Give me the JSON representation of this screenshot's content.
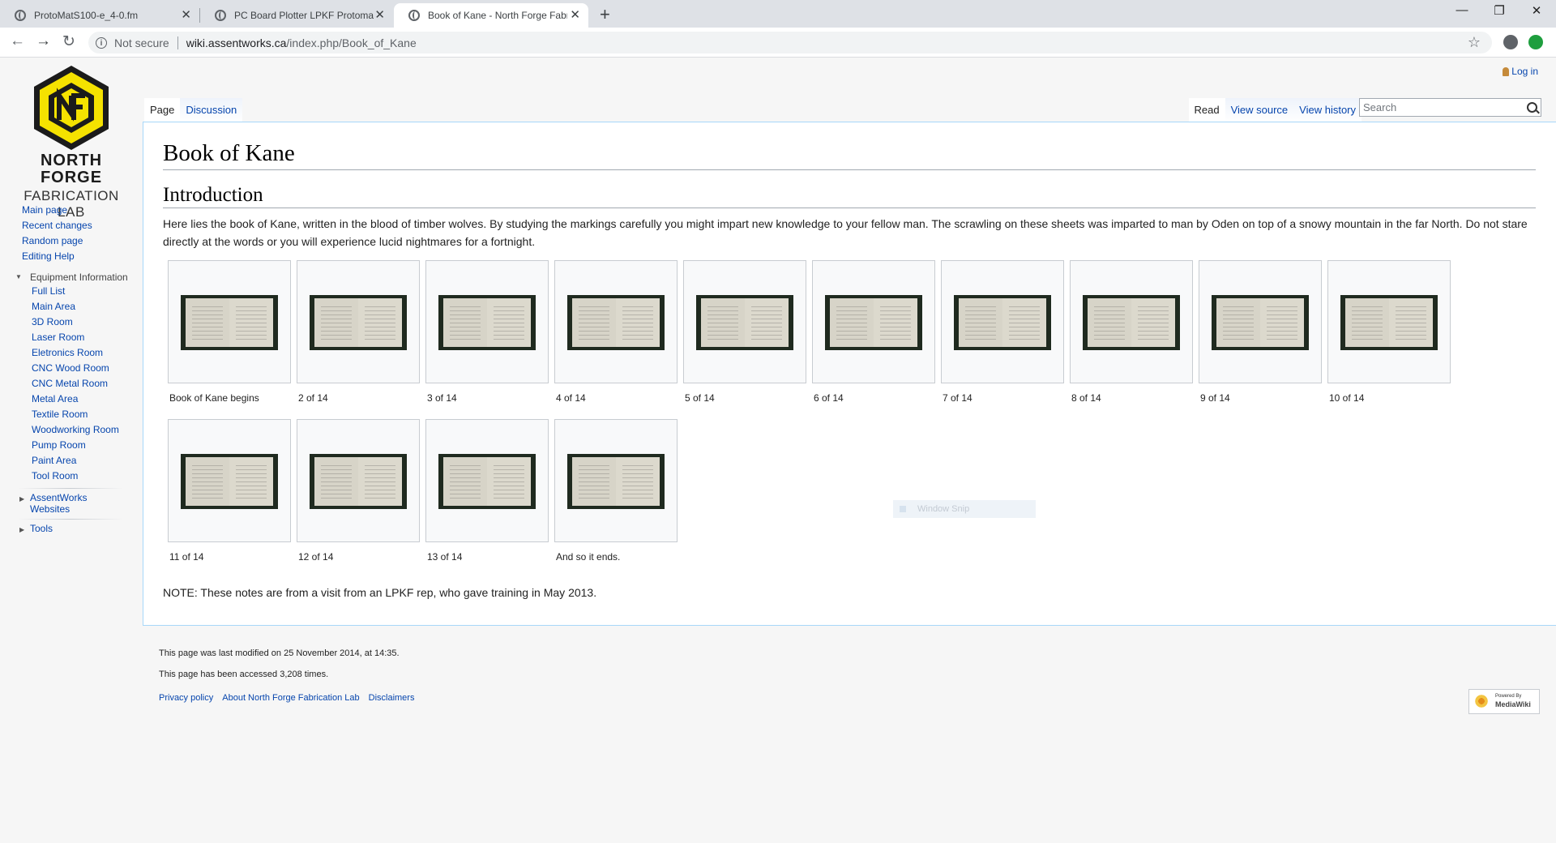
{
  "browser": {
    "tabs": [
      {
        "title": "ProtoMatS100-e_4-0.fm",
        "active": false
      },
      {
        "title": "PC Board Plotter LPKF Protomat",
        "active": false
      },
      {
        "title": "Book of Kane - North Forge Fabr",
        "active": true
      }
    ],
    "security": "Not secure",
    "url_host": "wiki.assentworks.ca",
    "url_path": "/index.php/Book_of_Kane",
    "new_tab": "+",
    "close_glyph": "✕",
    "win_minimize": "—",
    "win_maximize": "❐",
    "win_close": "✕",
    "back_glyph": "←",
    "forward_glyph": "→",
    "reload_glyph": "↻",
    "star_glyph": "☆"
  },
  "logo": {
    "line1": "NORTH",
    "line2": "FORGE",
    "line3": "FABRICATION LAB",
    "brand_yellow": "#f5e200"
  },
  "sidebar": {
    "main": [
      "Main page",
      "Recent changes",
      "Random page",
      "Editing Help"
    ],
    "equipment_heading": "Equipment Information",
    "equipment": [
      "Full List",
      "Main Area",
      "3D Room",
      "Laser Room",
      "Eletronics Room",
      "CNC Wood Room",
      "CNC Metal Room",
      "Metal Area",
      "Textile Room",
      "Woodworking Room",
      "Pump Room",
      "Paint Area",
      "Tool Room"
    ],
    "assentworks": "AssentWorks Websites",
    "tools": "Tools"
  },
  "personal": {
    "login": "Log in"
  },
  "page_tabs": {
    "page": "Page",
    "discussion": "Discussion"
  },
  "view_tabs": {
    "read": "Read",
    "view_source": "View source",
    "view_history": "View history"
  },
  "search": {
    "placeholder": "Search"
  },
  "article": {
    "title": "Book of Kane",
    "section": "Introduction",
    "intro": "Here lies the book of Kane, written in the blood of timber wolves. By studying the markings carefully you might impart new knowledge to your fellow man. The scrawling on these sheets was imparted to man by Oden on top of a snowy mountain in the far North. Do not stare directly at the words or you will experience lucid nightmares for a fortnight.",
    "gallery": [
      "Book of Kane begins",
      "2 of 14",
      "3 of 14",
      "4 of 14",
      "5 of 14",
      "6 of 14",
      "7 of 14",
      "8 of 14",
      "9 of 14",
      "10 of 14",
      "11 of 14",
      "12 of 14",
      "13 of 14",
      "And so it ends."
    ],
    "note": "NOTE: These notes are from a visit from an LPKF rep, who gave training in May 2013."
  },
  "overlay": {
    "window_snip": "Window Snip"
  },
  "footer": {
    "modified": "This page was last modified on 25 November 2014, at 14:35.",
    "accessed": "This page has been accessed 3,208 times.",
    "links": [
      "Privacy policy",
      "About North Forge Fabrication Lab",
      "Disclaimers"
    ],
    "badge_small": "Powered By",
    "badge_big": "MediaWiki"
  }
}
